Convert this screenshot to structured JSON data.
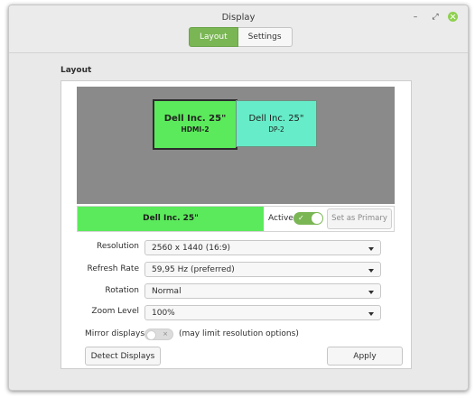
{
  "window": {
    "title": "Display",
    "controls": {
      "minimize": "–",
      "maximize": "⤢",
      "close": "×"
    }
  },
  "tabs": [
    {
      "label": "Layout",
      "active": true
    },
    {
      "label": "Settings",
      "active": false
    }
  ],
  "layout": {
    "section_label": "Layout",
    "monitors": [
      {
        "name": "Dell Inc. 25\"",
        "port": "HDMI-2",
        "color": "#5bea5b",
        "selected": true
      },
      {
        "name": "Dell Inc. 25\"",
        "port": "DP-2",
        "color": "#66ecc8",
        "selected": false
      }
    ],
    "selected_monitor": {
      "name": "Dell Inc. 25\"",
      "active_label": "Active",
      "active": true,
      "set_primary_label": "Set as Primary"
    },
    "settings": {
      "resolution": {
        "label": "Resolution",
        "value": "2560 x 1440 (16:9)"
      },
      "refresh_rate": {
        "label": "Refresh Rate",
        "value": "59,95 Hz (preferred)"
      },
      "rotation": {
        "label": "Rotation",
        "value": "Normal"
      },
      "zoom_level": {
        "label": "Zoom Level",
        "value": "100%"
      }
    },
    "mirror": {
      "label": "Mirror displays",
      "enabled": false,
      "note": "(may limit resolution options)"
    },
    "buttons": {
      "detect": "Detect Displays",
      "apply": "Apply"
    }
  },
  "colors": {
    "accent": "#7ab654",
    "selected_monitor": "#5bea5b",
    "other_monitor": "#66ecc8",
    "canvas": "#8a8a8a"
  }
}
